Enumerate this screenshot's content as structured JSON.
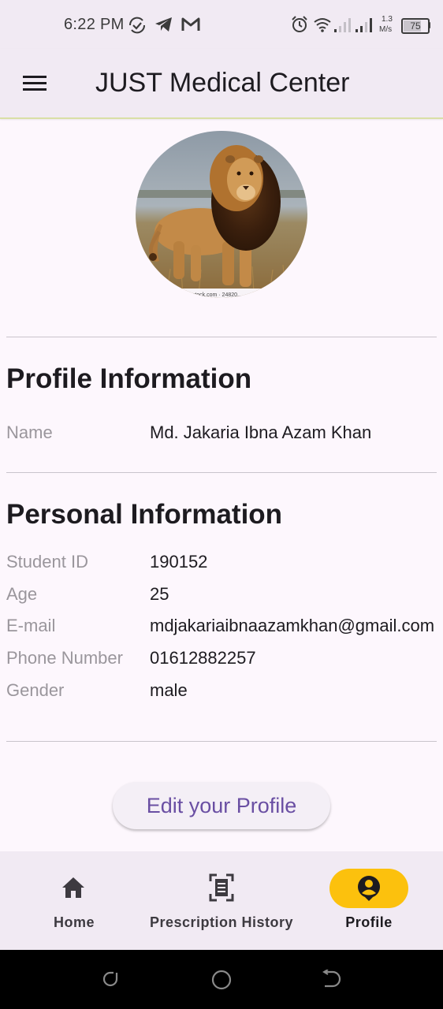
{
  "status_bar": {
    "time": "6:22 PM",
    "net_speed_top": "1.3",
    "net_speed_bottom": "M/s",
    "battery": "75"
  },
  "app_bar": {
    "title": "JUST Medical Center",
    "menu_icon": "hamburger-menu-icon"
  },
  "profile_image": {
    "watermark": "...stock.com · 24820..."
  },
  "profile_section": {
    "title": "Profile Information",
    "name_label": "Name",
    "name_value": "Md. Jakaria Ibna Azam Khan"
  },
  "personal_section": {
    "title": "Personal Information",
    "rows": [
      {
        "label": "Student ID",
        "value": "190152"
      },
      {
        "label": "Age",
        "value": "25"
      },
      {
        "label": "E-mail",
        "value": "mdjakariaibnaazamkhan@gmail.com"
      },
      {
        "label": "Phone Number",
        "value": "01612882257"
      },
      {
        "label": "Gender",
        "value": "male"
      }
    ]
  },
  "edit_button": {
    "label": "Edit your Profile"
  },
  "bottom_nav": {
    "items": [
      {
        "label": "Home",
        "icon": "home-icon"
      },
      {
        "label": "Prescription History",
        "icon": "document-scan-icon"
      },
      {
        "label": "Profile",
        "icon": "account-pin-icon"
      }
    ],
    "active_index": 2,
    "active_color": "#fcc10d"
  },
  "colors": {
    "app_bar_bg": "#f1eaf3",
    "page_bg": "#fdf7fd",
    "button_text": "#6a4fa3",
    "accent_pill": "#fcc10d"
  }
}
